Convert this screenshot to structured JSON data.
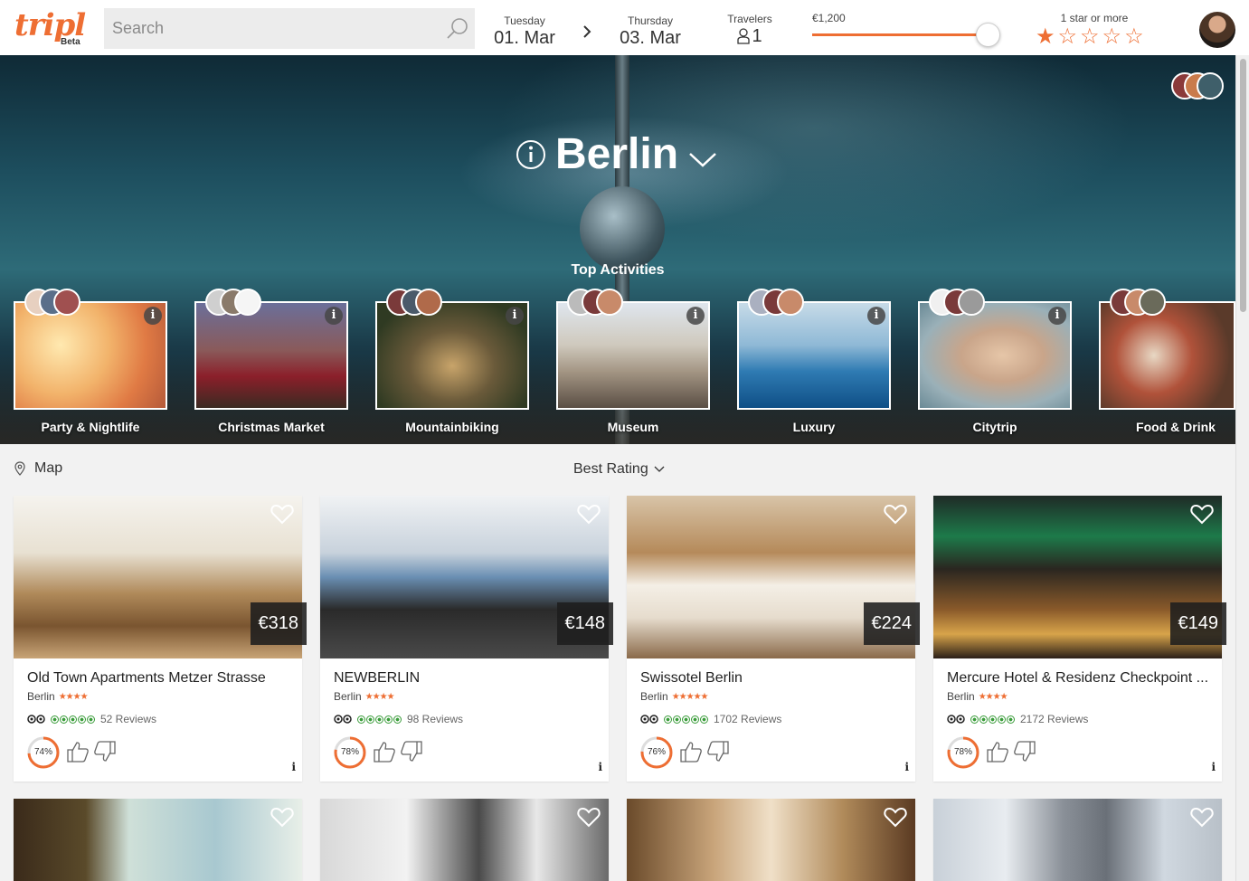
{
  "header": {
    "logo_text": "tripl",
    "logo_badge": "Beta",
    "search_placeholder": "Search",
    "checkin": {
      "day": "Tuesday",
      "date": "01. Mar"
    },
    "checkout": {
      "day": "Thursday",
      "date": "03. Mar"
    },
    "travelers": {
      "label": "Travelers",
      "count": "1"
    },
    "price": {
      "label": "€1,200",
      "slider_fraction": 0.93
    },
    "stars": {
      "label": "1 star or more",
      "selected": 1,
      "total": 5
    },
    "colors": {
      "accent": "#ee6e33"
    }
  },
  "hero": {
    "city": "Berlin",
    "top_activities_label": "Top Activities",
    "activities": [
      {
        "label": "Party & Nightlife",
        "icon": "info-icon"
      },
      {
        "label": "Christmas Market",
        "icon": "info-icon"
      },
      {
        "label": "Mountainbiking",
        "icon": "info-icon"
      },
      {
        "label": "Museum",
        "icon": "info-icon"
      },
      {
        "label": "Luxury",
        "icon": "info-icon"
      },
      {
        "label": "Citytrip",
        "icon": "info-icon"
      },
      {
        "label": "Food & Drink",
        "icon": "info-icon"
      }
    ]
  },
  "toolbar": {
    "map_label": "Map",
    "sort_label": "Best Rating"
  },
  "hotels": [
    {
      "name": "Old Town Apartments Metzer Strasse",
      "city": "Berlin",
      "stars": "★★★★",
      "price": "€318",
      "reviews": "52 Reviews",
      "score": "74%",
      "score_value": 74
    },
    {
      "name": "NEWBERLIN",
      "city": "Berlin",
      "stars": "★★★★",
      "price": "€148",
      "reviews": "98 Reviews",
      "score": "78%",
      "score_value": 78
    },
    {
      "name": "Swissotel Berlin",
      "city": "Berlin",
      "stars": "★★★★★",
      "price": "€224",
      "reviews": "1702 Reviews",
      "score": "76%",
      "score_value": 76
    },
    {
      "name": "Mercure Hotel & Residenz Checkpoint ...",
      "city": "Berlin",
      "stars": "★★★★",
      "price": "€149",
      "reviews": "2172 Reviews",
      "score": "78%",
      "score_value": 78
    }
  ]
}
